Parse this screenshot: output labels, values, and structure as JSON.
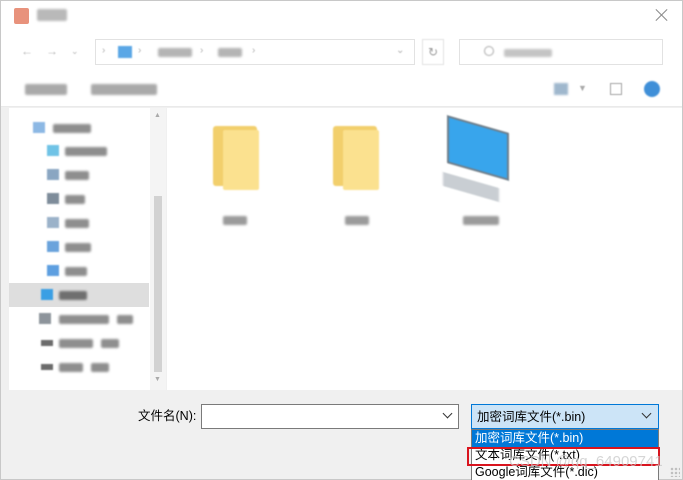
{
  "window": {
    "close_icon": "close-icon",
    "accent": "#0078d7"
  },
  "filename": {
    "label": "文件名(N):",
    "value": "",
    "placeholder": ""
  },
  "filetype": {
    "selected": "加密词库文件(*.bin)",
    "options": [
      "加密词库文件(*.bin)",
      "文本词库文件(*.txt)",
      "Google词库文件(*.dic)"
    ],
    "highlighted_index": 0,
    "marked_index": 1,
    "highlight_color": "#0078d7",
    "mark_color": "#d9141e"
  },
  "watermark": {
    "text": "CSDN @qq_64909741"
  },
  "icons": {
    "folder": "folder-icon",
    "computer": "computer-icon",
    "search": "search-icon",
    "help": "help-icon"
  }
}
